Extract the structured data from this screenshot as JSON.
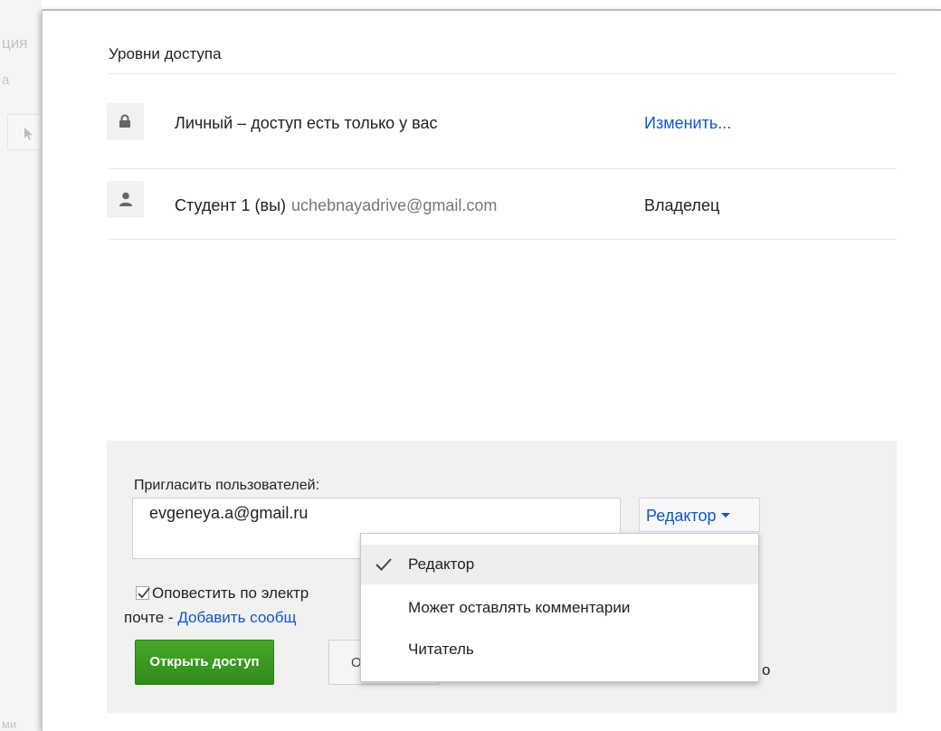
{
  "background": {
    "partial_text_1": "ция",
    "partial_text_2": "а",
    "partial_text_3": "ми"
  },
  "access": {
    "section_title": "Уровни доступа",
    "privacy": {
      "icon": "lock-icon",
      "text": "Личный – доступ есть только у вас",
      "change_link": "Изменить..."
    },
    "owner": {
      "icon": "person-icon",
      "name": "Студент 1 (вы)",
      "email": "uchebnayadrive@gmail.com",
      "role": "Владелец"
    }
  },
  "invite": {
    "label": "Пригласить пользователей:",
    "input_value": "evgeneya.a@gmail.ru",
    "role_button": "Редактор",
    "notify_line1": "Оповестить по электр",
    "notify_line2_prefix": "почте - ",
    "notify_link": "Добавить сообщ",
    "notify_checked": true,
    "share_button": "Открыть доступ",
    "cancel_button_partial": "О",
    "tail_partial": "о"
  },
  "role_menu": {
    "items": [
      {
        "label": "Редактор",
        "selected": true
      },
      {
        "label": "Может оставлять комментарии",
        "selected": false
      },
      {
        "label": "Читатель",
        "selected": false
      }
    ]
  },
  "colors": {
    "link": "#1155cc",
    "share_button": "#3c9c23",
    "panel_bg": "#f1f1f1"
  }
}
